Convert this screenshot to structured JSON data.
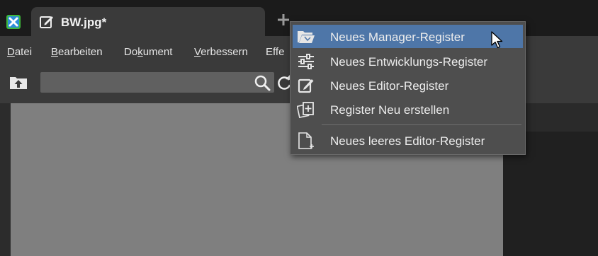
{
  "tab": {
    "title": "BW.jpg*"
  },
  "menu": {
    "items": [
      {
        "ul": "D",
        "rest": "atei"
      },
      {
        "ul": "B",
        "rest": "earbeiten"
      },
      {
        "pre": "Do",
        "ul": "k",
        "rest": "ument"
      },
      {
        "ul": "V",
        "rest": "erbessern"
      },
      {
        "pre": "Effe",
        "ul": "",
        "rest": ""
      }
    ]
  },
  "dropdown": {
    "items": [
      {
        "label": "Neues Manager-Register",
        "icon": "folder-open-icon",
        "active": true
      },
      {
        "label": "Neues Entwicklungs-Register",
        "icon": "sliders-icon"
      },
      {
        "label": "Neues Editor-Register",
        "icon": "edit-icon"
      },
      {
        "label": "Register Neu erstellen",
        "icon": "recreate-tabs-icon"
      },
      {
        "label": "Neues leeres Editor-Register",
        "icon": "blank-page-icon"
      }
    ]
  },
  "colors": {
    "menu_bg": "#3a3a3a",
    "highlight": "#4e76a8",
    "canvas": "#7f7f7f",
    "logo_green": "#3fb93b"
  }
}
